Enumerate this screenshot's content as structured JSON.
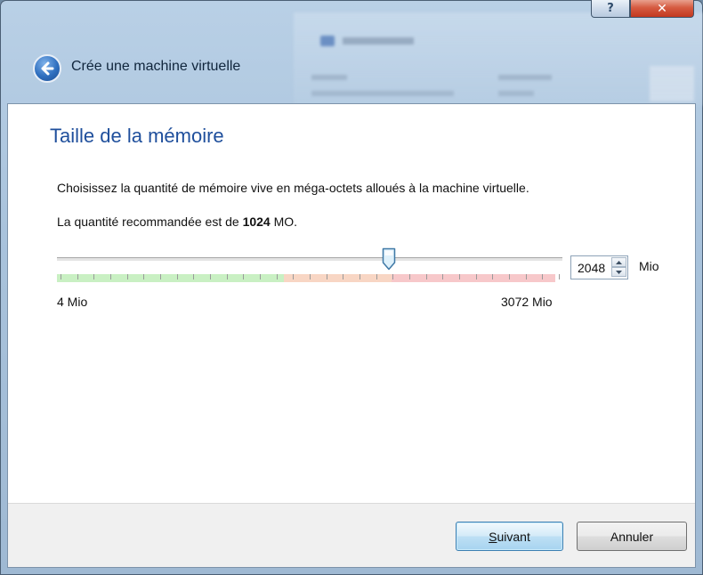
{
  "window": {
    "title": "Crée une machine virtuelle",
    "help_glyph": "?",
    "close_glyph": "✕"
  },
  "page": {
    "title": "Taille de la mémoire",
    "description": "Choisissez la quantité de mémoire vive en méga-octets alloués à la machine virtuelle.",
    "recommended_prefix": "La quantité recommandée est de ",
    "recommended_value": "1024",
    "recommended_suffix": " MO."
  },
  "memory_slider": {
    "min_label": "4 Mio",
    "max_label": "3072 Mio",
    "min": 4,
    "max": 3072,
    "value": 2048,
    "zones": {
      "green_fraction": 0.449,
      "orange_fraction": 0.213,
      "red_fraction": 0.338
    }
  },
  "memory_spin": {
    "value": "2048",
    "unit": "Mio"
  },
  "buttons": {
    "next_accel": "S",
    "next_rest": "uivant",
    "cancel": "Annuler"
  },
  "colors": {
    "title_blue": "#1f4f9c",
    "zone_green": "#c9f0c3",
    "zone_orange": "#f8d6c4",
    "zone_red": "#f7c8ca"
  }
}
